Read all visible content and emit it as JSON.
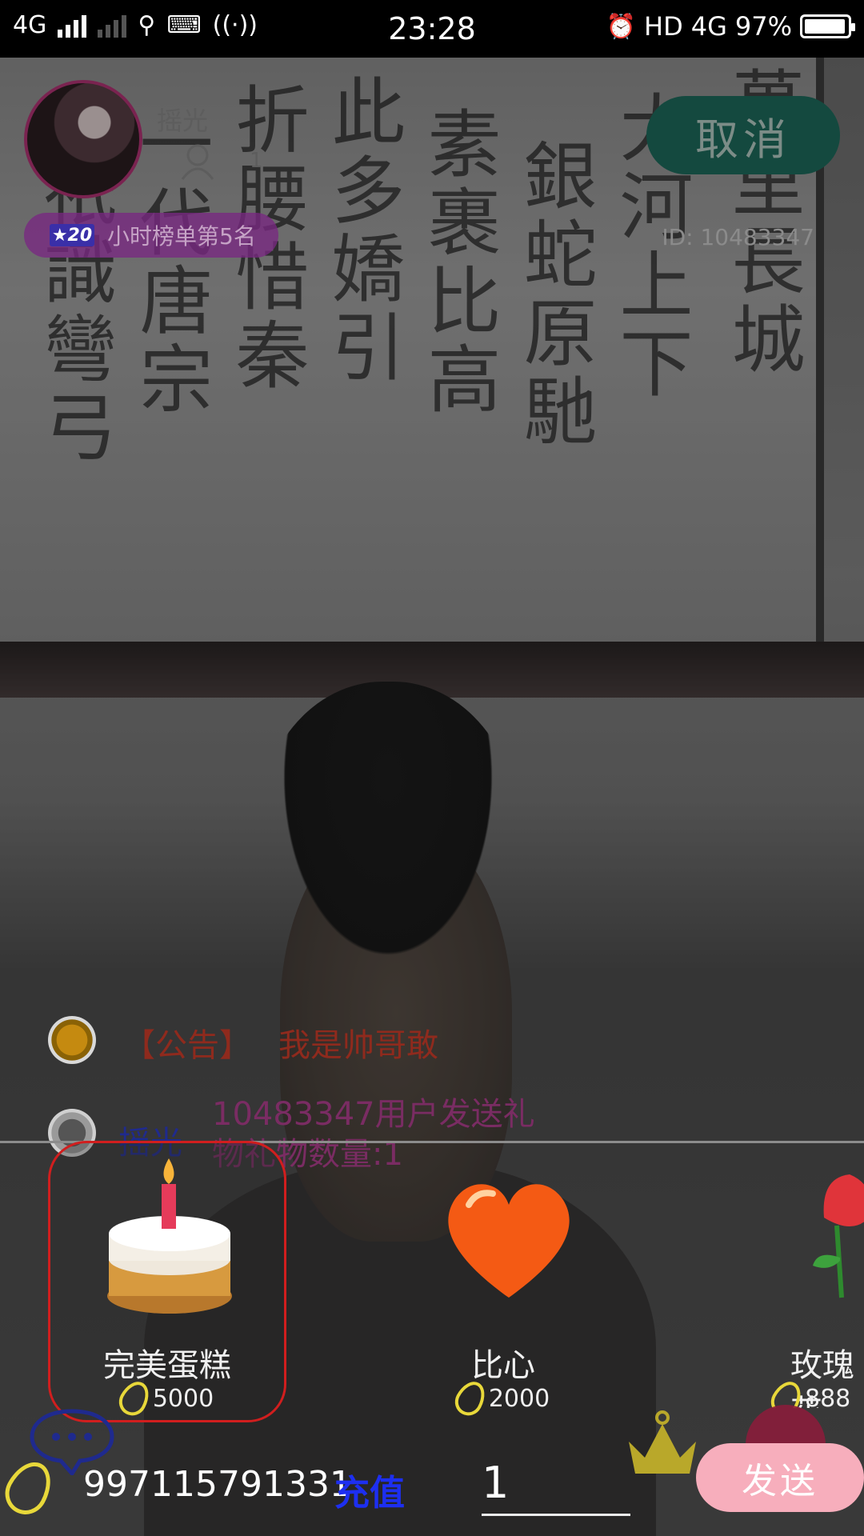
{
  "status_bar": {
    "network": "4G",
    "time": "23:28",
    "hd": "HD",
    "network2": "4G",
    "battery": "97%",
    "battery_level": 0.97
  },
  "host": {
    "name": "摇光",
    "viewer_count": "1",
    "rank_level": "★20",
    "rank_text": "小时榜单第5名",
    "room_id": "ID: 10483347"
  },
  "cancel_label": "取消",
  "chat": [
    {
      "tag": "【公告】",
      "text": "我是帅哥敢"
    },
    {
      "name": "摇光",
      "text": "10483347用户发送礼物礼物数量:1"
    }
  ],
  "gifts": [
    {
      "name": "完美蛋糕",
      "price": "5000",
      "icon": "cake-icon",
      "selected": true
    },
    {
      "name": "比心",
      "price": "2000",
      "icon": "heart-icon",
      "selected": false
    },
    {
      "name": "玫瑰花",
      "price": "888",
      "icon": "rose-icon",
      "selected": false
    }
  ],
  "bottom": {
    "balance": "997115791331",
    "recharge_label": "充值",
    "quantity": "1",
    "send_label": "发送"
  },
  "colors": {
    "selected_border": "#d11e1e",
    "recharge": "#1d2ff0",
    "send_button": "#f7aebc",
    "cancel_button": "#14493f"
  }
}
